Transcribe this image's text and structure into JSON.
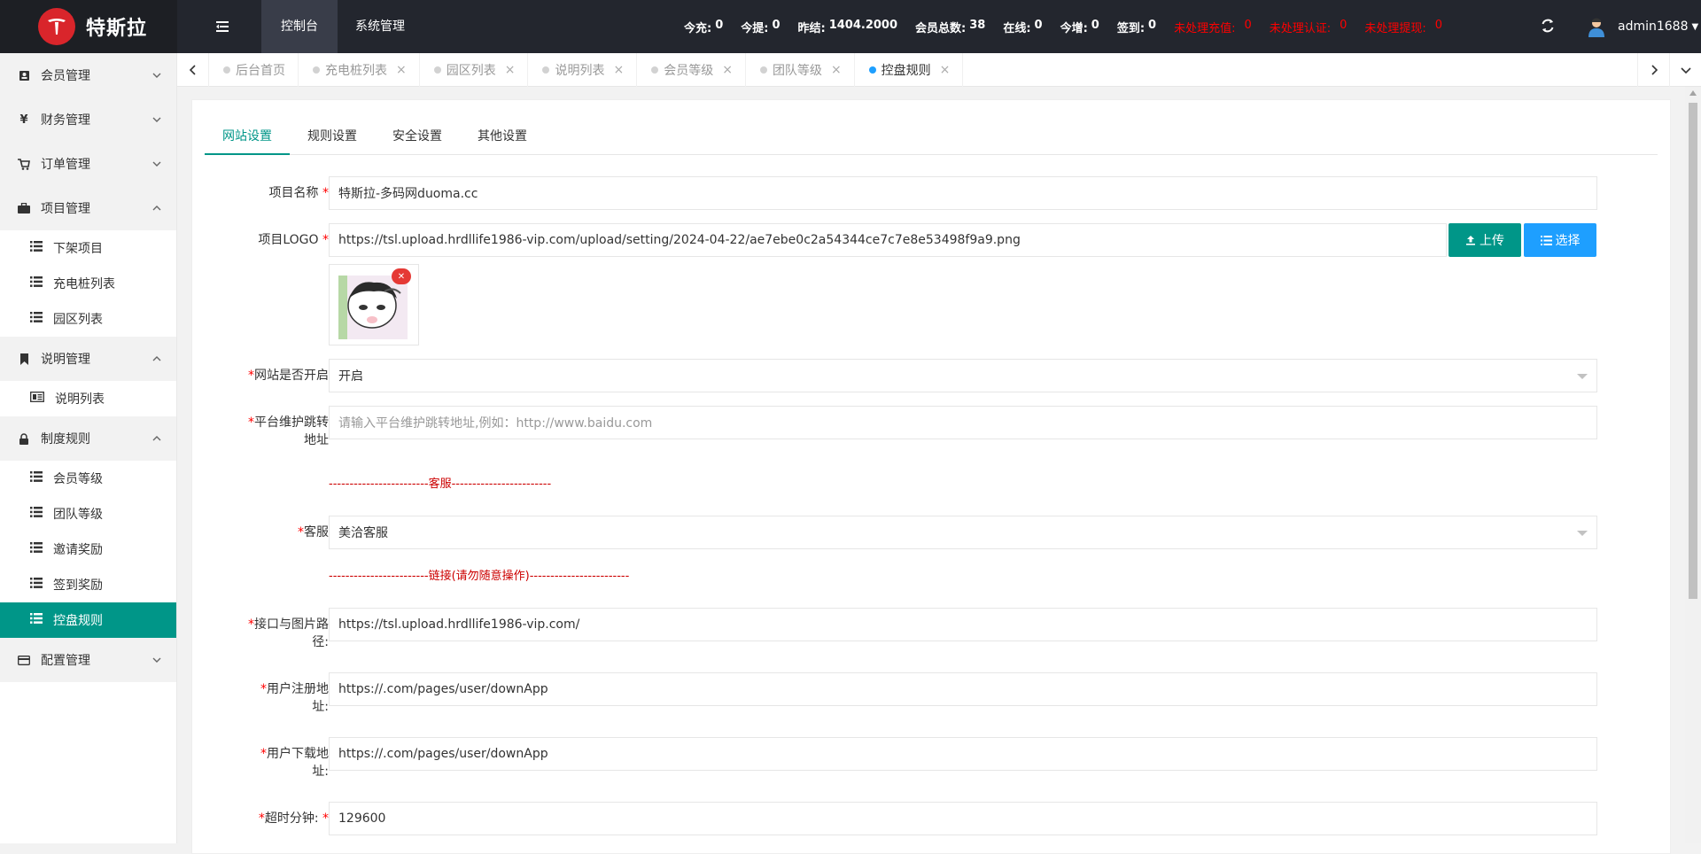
{
  "brand": {
    "title": "特斯拉",
    "logo_text": "TESLA"
  },
  "topnav": {
    "console": "控制台",
    "system": "系统管理"
  },
  "stats": [
    {
      "label": "今充:",
      "value": "0"
    },
    {
      "label": "今提:",
      "value": "0"
    },
    {
      "label": "昨结:",
      "value": "1404.2000"
    },
    {
      "label": "会员总数:",
      "value": "38"
    },
    {
      "label": "在线:",
      "value": "0"
    },
    {
      "label": "今增:",
      "value": "0"
    },
    {
      "label": "签到:",
      "value": "0"
    }
  ],
  "alerts": [
    {
      "label": "未处理充值:",
      "value": "0"
    },
    {
      "label": "未处理认证:",
      "value": "0"
    },
    {
      "label": "未处理提现:",
      "value": "0"
    }
  ],
  "user": {
    "name": "admin1688"
  },
  "sidebar": {
    "member": "会员管理",
    "finance": "财务管理",
    "order": "订单管理",
    "project": "项目管理",
    "project_items": [
      "下架项目",
      "充电桩列表",
      "园区列表"
    ],
    "explain": "说明管理",
    "explain_items": [
      "说明列表"
    ],
    "rules": "制度规则",
    "rules_items": [
      "会员等级",
      "团队等级",
      "邀请奖励",
      "签到奖励",
      "控盘规则"
    ],
    "config": "配置管理"
  },
  "tabs": [
    "后台首页",
    "充电桩列表",
    "园区列表",
    "说明列表",
    "会员等级",
    "团队等级",
    "控盘规则"
  ],
  "content_tabs": [
    "网站设置",
    "规则设置",
    "安全设置",
    "其他设置"
  ],
  "form": {
    "project_name_label": "项目名称",
    "project_name_value": "特斯拉-多码网duoma.cc",
    "logo_label": "项目LOGO",
    "logo_value": "https://tsl.upload.hrdllife1986-vip.com/upload/setting/2024-04-22/ae7ebe0c2a54344ce7c7e8e53498f9a9.png",
    "upload_btn": "上传",
    "choose_btn": "选择",
    "site_open_label": "网站是否开启",
    "site_open_value": "开启",
    "maint_label_1": "平台维护跳转",
    "maint_label_2": "地址",
    "maint_placeholder": "请输入平台维护跳转地址,例如：http://www.baidu.com",
    "divider_service": "------------------------客服------------------------",
    "service_label": "客服",
    "service_value": "美洽客服",
    "divider_link": "------------------------链接(请勿随意操作)------------------------",
    "api_label_1": "接口与图片路",
    "api_label_2": "径:",
    "api_value": "https://tsl.upload.hrdllife1986-vip.com/",
    "reg_label_1": "用户注册地",
    "reg_label_2": "址:",
    "reg_value": "https://.com/pages/user/downApp",
    "dl_label_1": "用户下载地",
    "dl_label_2": "址:",
    "dl_value": "https://.com/pages/user/downApp",
    "timeout_label": "超时分钟:",
    "timeout_value": "129600"
  },
  "colors": {
    "accent": "#009688",
    "blue": "#1e9fff",
    "alert": "#ff0000",
    "header": "#23262e"
  }
}
